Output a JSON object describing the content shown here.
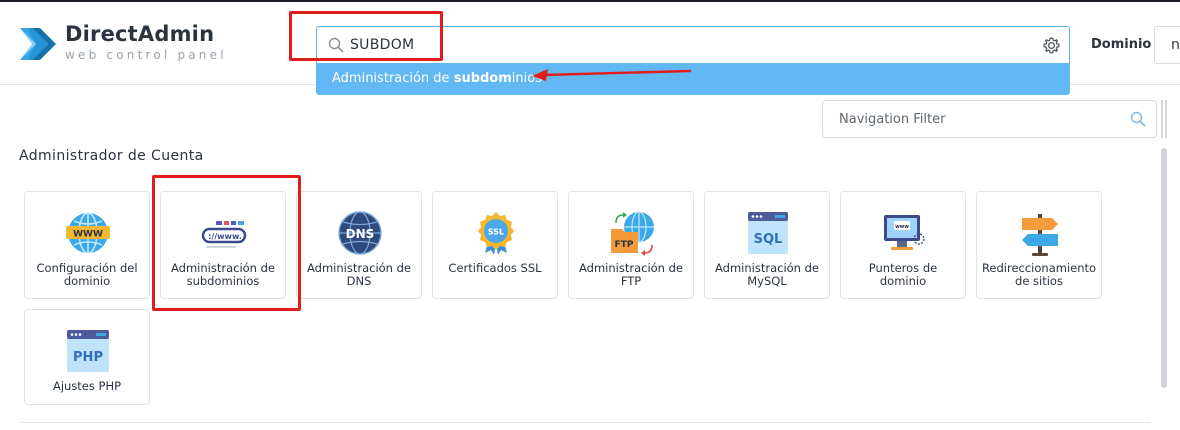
{
  "brand": {
    "name": "DirectAdmin",
    "tagline": "web control panel"
  },
  "search": {
    "value": "SUBDOM",
    "icon": "search-icon",
    "settings_icon": "gear-icon"
  },
  "suggestion": {
    "prefix": "Administración de ",
    "match": "subdom",
    "suffix": "inios"
  },
  "domain": {
    "label": "Dominio",
    "selected": "nc"
  },
  "filter": {
    "placeholder": "Navigation Filter"
  },
  "section": {
    "title": "Administrador de Cuenta",
    "tiles": [
      {
        "label": "Configuración del dominio",
        "icon": "www-globe-icon"
      },
      {
        "label": "Administración de subdominios",
        "icon": "subdomain-www-icon"
      },
      {
        "label": "Administración de DNS",
        "icon": "dns-globe-icon"
      },
      {
        "label": "Certificados SSL",
        "icon": "ssl-badge-icon"
      },
      {
        "label": "Administración de FTP",
        "icon": "ftp-folder-icon"
      },
      {
        "label": "Administración de MySQL",
        "icon": "sql-database-icon"
      },
      {
        "label": "Punteros de dominio",
        "icon": "domain-pointer-icon"
      },
      {
        "label": "Redireccionamiento de sitios",
        "icon": "signpost-icon"
      },
      {
        "label": "Ajustes PHP",
        "icon": "php-icon"
      }
    ]
  },
  "colors": {
    "accent": "#62b8f3",
    "annotation": "#e21d1d",
    "text": "#2b3340"
  }
}
